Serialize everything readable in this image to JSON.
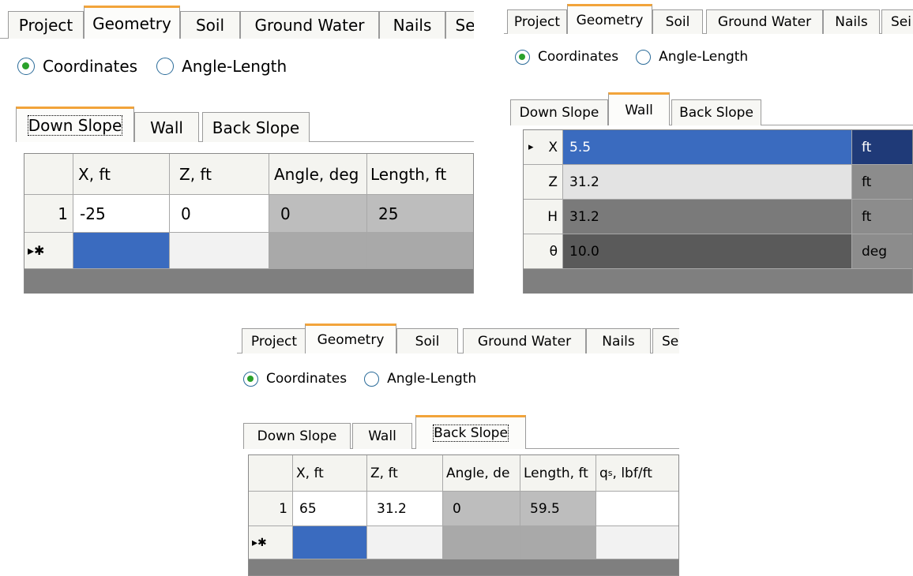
{
  "panel1": {
    "tabs": [
      "Project",
      "Geometry",
      "Soil",
      "Ground Water",
      "Nails",
      "Se"
    ],
    "radio": {
      "coordinates": "Coordinates",
      "angle_length": "Angle-Length"
    },
    "subtabs": [
      "Down Slope",
      "Wall",
      "Back Slope"
    ],
    "columns": [
      "X, ft",
      "Z, ft",
      "Angle, deg",
      "Length, ft"
    ],
    "row1": {
      "index": "1",
      "x": "-25",
      "z": "0",
      "angle": "0",
      "length": "25"
    },
    "new_row_marker": "▸✱"
  },
  "panel2": {
    "tabs": [
      "Project",
      "Geometry",
      "Soil",
      "Ground Water",
      "Nails",
      "Sei"
    ],
    "radio": {
      "coordinates": "Coordinates",
      "angle_length": "Angle-Length"
    },
    "subtabs": [
      "Down Slope",
      "Wall",
      "Back Slope"
    ],
    "rows": [
      {
        "marker": "▸",
        "name": "X",
        "value": "5.5",
        "unit": "ft"
      },
      {
        "marker": "",
        "name": "Z",
        "value": "31.2",
        "unit": "ft"
      },
      {
        "marker": "",
        "name": "H",
        "value": "31.2",
        "unit": "ft"
      },
      {
        "marker": "",
        "name": "θ",
        "value": "10.0",
        "unit": "deg"
      }
    ]
  },
  "panel3": {
    "tabs": [
      "Project",
      "Geometry",
      "Soil",
      "Ground Water",
      "Nails",
      "Sei"
    ],
    "radio": {
      "coordinates": "Coordinates",
      "angle_length": "Angle-Length"
    },
    "subtabs": [
      "Down Slope",
      "Wall",
      "Back Slope"
    ],
    "columns": [
      "X, ft",
      "Z, ft",
      "Angle, de",
      "Length, ft",
      "q",
      "s",
      ", lbf/ft"
    ],
    "row1": {
      "index": "1",
      "x": "65",
      "z": "31.2",
      "angle": "0",
      "length": "59.5",
      "qs": ""
    },
    "new_row_marker": "▸✱"
  }
}
